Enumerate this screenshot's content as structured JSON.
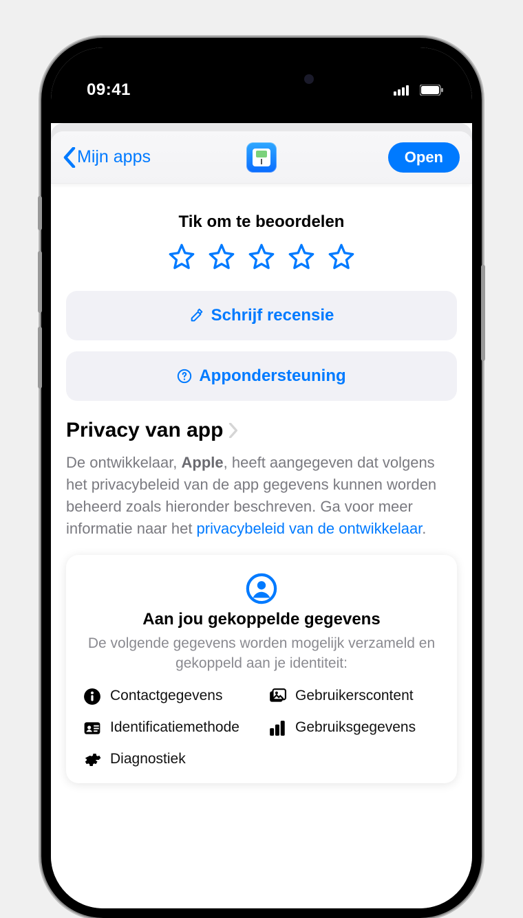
{
  "status": {
    "time": "09:41"
  },
  "nav": {
    "back_label": "Mijn apps",
    "open_label": "Open"
  },
  "rate": {
    "title": "Tik om te beoordelen",
    "write_review": "Schrijf recensie",
    "app_support": "Appondersteuning"
  },
  "privacy": {
    "heading": "Privacy van app",
    "desc_pre": "De ontwikkelaar, ",
    "developer": "Apple",
    "desc_mid": ", heeft aangegeven dat volgens het privacybeleid van de app gegevens kunnen worden beheerd zoals hieronder beschreven. Ga voor meer informatie naar het ",
    "link_text": "privacybeleid van de ontwikkelaar",
    "desc_post": "."
  },
  "card": {
    "title": "Aan jou gekoppelde gegevens",
    "subtitle": "De volgende gegevens worden mogelijk verzameld en gekoppeld aan je identiteit:",
    "items": [
      "Contactgegevens",
      "Gebruikerscontent",
      "Identificatiemethode",
      "Gebruiksgegevens",
      "Diagnostiek"
    ]
  }
}
